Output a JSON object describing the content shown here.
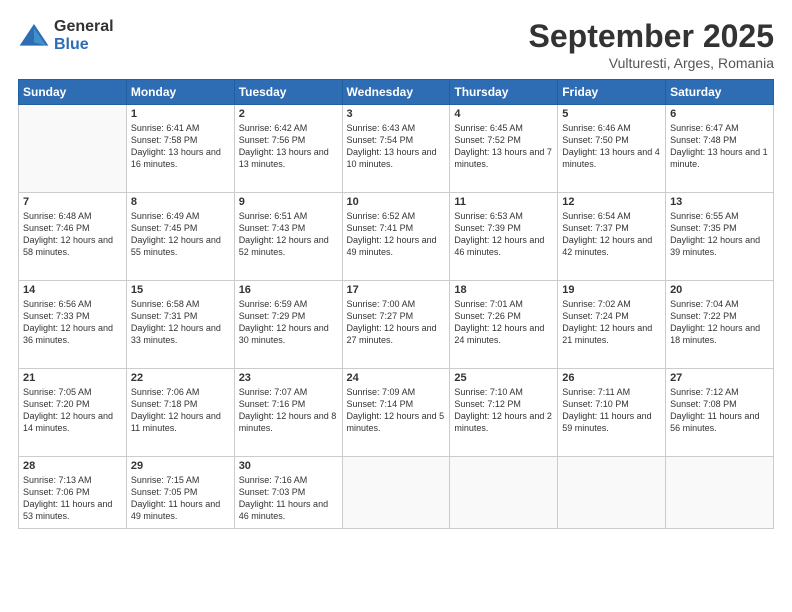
{
  "logo": {
    "general": "General",
    "blue": "Blue"
  },
  "title": {
    "month": "September 2025",
    "location": "Vulturesti, Arges, Romania"
  },
  "headers": [
    "Sunday",
    "Monday",
    "Tuesday",
    "Wednesday",
    "Thursday",
    "Friday",
    "Saturday"
  ],
  "weeks": [
    [
      {
        "day": "",
        "info": ""
      },
      {
        "day": "1",
        "info": "Sunrise: 6:41 AM\nSunset: 7:58 PM\nDaylight: 13 hours and 16 minutes."
      },
      {
        "day": "2",
        "info": "Sunrise: 6:42 AM\nSunset: 7:56 PM\nDaylight: 13 hours and 13 minutes."
      },
      {
        "day": "3",
        "info": "Sunrise: 6:43 AM\nSunset: 7:54 PM\nDaylight: 13 hours and 10 minutes."
      },
      {
        "day": "4",
        "info": "Sunrise: 6:45 AM\nSunset: 7:52 PM\nDaylight: 13 hours and 7 minutes."
      },
      {
        "day": "5",
        "info": "Sunrise: 6:46 AM\nSunset: 7:50 PM\nDaylight: 13 hours and 4 minutes."
      },
      {
        "day": "6",
        "info": "Sunrise: 6:47 AM\nSunset: 7:48 PM\nDaylight: 13 hours and 1 minute."
      }
    ],
    [
      {
        "day": "7",
        "info": "Sunrise: 6:48 AM\nSunset: 7:46 PM\nDaylight: 12 hours and 58 minutes."
      },
      {
        "day": "8",
        "info": "Sunrise: 6:49 AM\nSunset: 7:45 PM\nDaylight: 12 hours and 55 minutes."
      },
      {
        "day": "9",
        "info": "Sunrise: 6:51 AM\nSunset: 7:43 PM\nDaylight: 12 hours and 52 minutes."
      },
      {
        "day": "10",
        "info": "Sunrise: 6:52 AM\nSunset: 7:41 PM\nDaylight: 12 hours and 49 minutes."
      },
      {
        "day": "11",
        "info": "Sunrise: 6:53 AM\nSunset: 7:39 PM\nDaylight: 12 hours and 46 minutes."
      },
      {
        "day": "12",
        "info": "Sunrise: 6:54 AM\nSunset: 7:37 PM\nDaylight: 12 hours and 42 minutes."
      },
      {
        "day": "13",
        "info": "Sunrise: 6:55 AM\nSunset: 7:35 PM\nDaylight: 12 hours and 39 minutes."
      }
    ],
    [
      {
        "day": "14",
        "info": "Sunrise: 6:56 AM\nSunset: 7:33 PM\nDaylight: 12 hours and 36 minutes."
      },
      {
        "day": "15",
        "info": "Sunrise: 6:58 AM\nSunset: 7:31 PM\nDaylight: 12 hours and 33 minutes."
      },
      {
        "day": "16",
        "info": "Sunrise: 6:59 AM\nSunset: 7:29 PM\nDaylight: 12 hours and 30 minutes."
      },
      {
        "day": "17",
        "info": "Sunrise: 7:00 AM\nSunset: 7:27 PM\nDaylight: 12 hours and 27 minutes."
      },
      {
        "day": "18",
        "info": "Sunrise: 7:01 AM\nSunset: 7:26 PM\nDaylight: 12 hours and 24 minutes."
      },
      {
        "day": "19",
        "info": "Sunrise: 7:02 AM\nSunset: 7:24 PM\nDaylight: 12 hours and 21 minutes."
      },
      {
        "day": "20",
        "info": "Sunrise: 7:04 AM\nSunset: 7:22 PM\nDaylight: 12 hours and 18 minutes."
      }
    ],
    [
      {
        "day": "21",
        "info": "Sunrise: 7:05 AM\nSunset: 7:20 PM\nDaylight: 12 hours and 14 minutes."
      },
      {
        "day": "22",
        "info": "Sunrise: 7:06 AM\nSunset: 7:18 PM\nDaylight: 12 hours and 11 minutes."
      },
      {
        "day": "23",
        "info": "Sunrise: 7:07 AM\nSunset: 7:16 PM\nDaylight: 12 hours and 8 minutes."
      },
      {
        "day": "24",
        "info": "Sunrise: 7:09 AM\nSunset: 7:14 PM\nDaylight: 12 hours and 5 minutes."
      },
      {
        "day": "25",
        "info": "Sunrise: 7:10 AM\nSunset: 7:12 PM\nDaylight: 12 hours and 2 minutes."
      },
      {
        "day": "26",
        "info": "Sunrise: 7:11 AM\nSunset: 7:10 PM\nDaylight: 11 hours and 59 minutes."
      },
      {
        "day": "27",
        "info": "Sunrise: 7:12 AM\nSunset: 7:08 PM\nDaylight: 11 hours and 56 minutes."
      }
    ],
    [
      {
        "day": "28",
        "info": "Sunrise: 7:13 AM\nSunset: 7:06 PM\nDaylight: 11 hours and 53 minutes."
      },
      {
        "day": "29",
        "info": "Sunrise: 7:15 AM\nSunset: 7:05 PM\nDaylight: 11 hours and 49 minutes."
      },
      {
        "day": "30",
        "info": "Sunrise: 7:16 AM\nSunset: 7:03 PM\nDaylight: 11 hours and 46 minutes."
      },
      {
        "day": "",
        "info": ""
      },
      {
        "day": "",
        "info": ""
      },
      {
        "day": "",
        "info": ""
      },
      {
        "day": "",
        "info": ""
      }
    ]
  ]
}
